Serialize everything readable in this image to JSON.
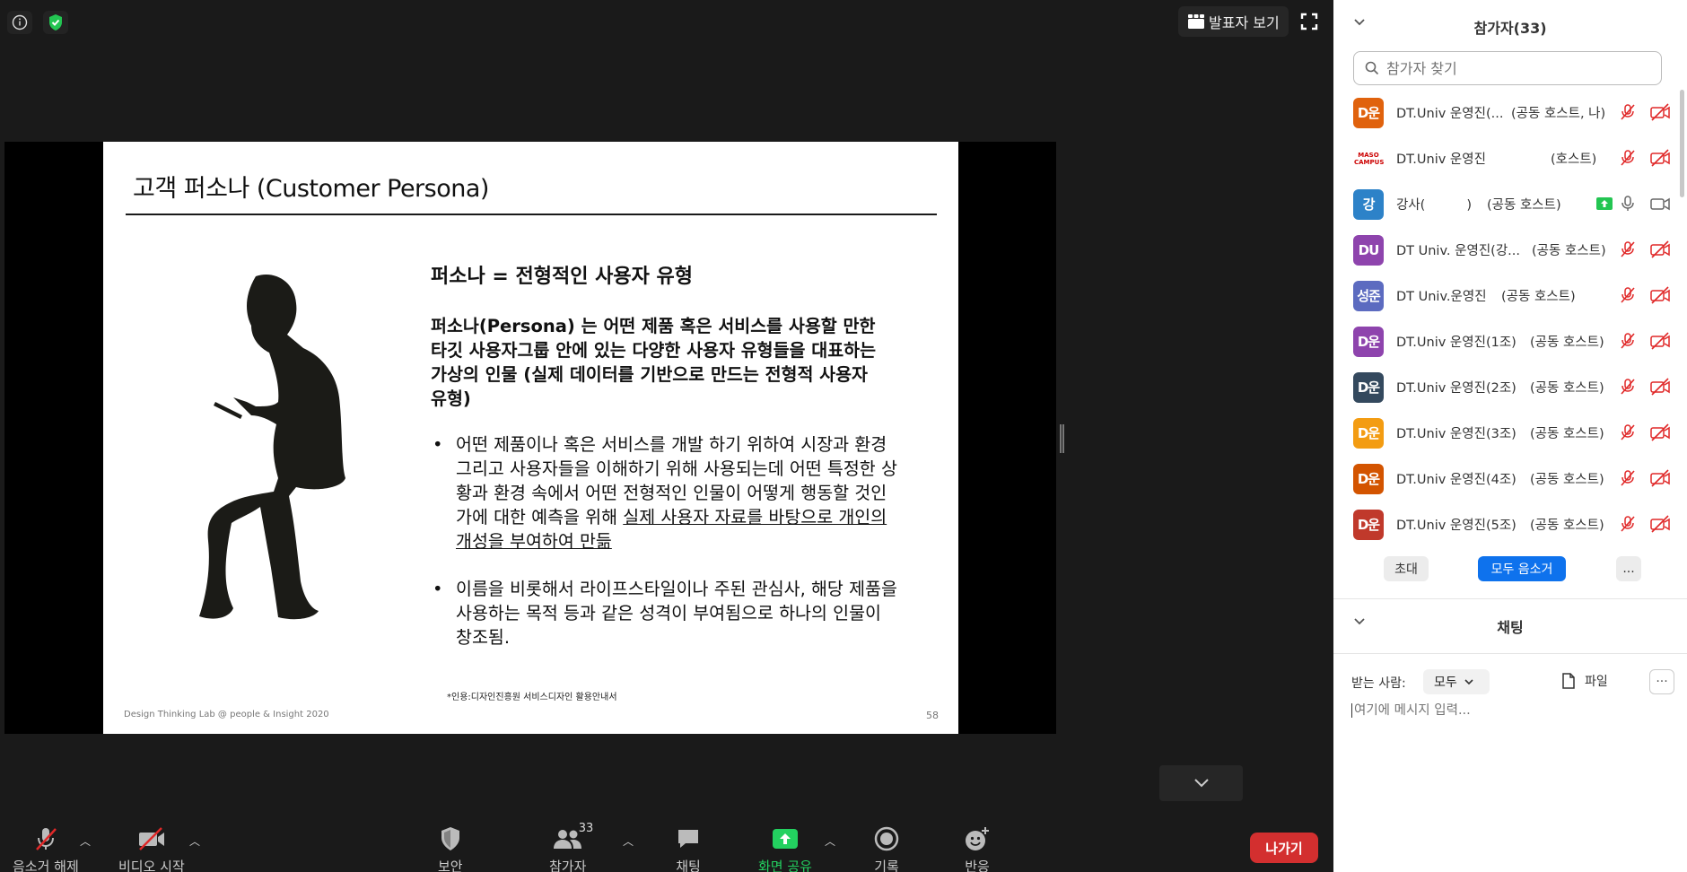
{
  "top_bar": {
    "info_icon": "info-icon",
    "security_icon": "shield-check-icon",
    "speaker_view_label": "발표자 보기",
    "fullscreen_icon": "fullscreen-icon"
  },
  "slide": {
    "title": "고객 퍼소나 (Customer Persona)",
    "heading": "퍼소나 = 전형적인 사용자 유형",
    "paragraph": "퍼소나(Persona) 는 어떤 제품 혹은 서비스를 사용할 만한 타깃 사용자그룹 안에 있는 다양한 사용자 유형들을 대표하는 가상의 인물 (실제 데이터를 기반으로 만드는 전형적 사용자 유형)",
    "bullet1_plain": "어떤 제품이나 혹은 서비스를 개발 하기 위하여 시장과 환경 그리고 사용자들을 이해하기 위해 사용되는데 어떤 특정한 상황과 환경 속에서 어떤 전형적인 인물이 어떻게 행동할 것인가에 대한 예측을 위해 ",
    "bullet1_underlined": "실제 사용자 자료를 바탕으로 개인의 개성을 부여하여 만듦",
    "bullet2": "이름을 비롯해서 라이프스타일이나 주된 관심사, 해당 제품을 사용하는 목적 등과 같은 성격이 부여됨으로 하나의 인물이 창조됨.",
    "citation": "*인용:디자인진흥원 서비스디자인 활용안내서",
    "footer": "Design Thinking Lab @ people & Insight 2020",
    "page_number": "58"
  },
  "toolbar": {
    "unmute_label": "음소거 해제",
    "video_label": "비디오 시작",
    "security_label": "보안",
    "participants_label": "참가자",
    "participants_count": "33",
    "chat_label": "채팅",
    "share_label": "화면 공유",
    "record_label": "기록",
    "reactions_label": "반응",
    "leave_label": "나가기"
  },
  "participants_panel": {
    "title": "참가자(33)",
    "search_placeholder": "참가자 찾기",
    "participants": [
      {
        "avatar": "D운",
        "color": "#e0620d",
        "name": "DT.Univ 운영진(...",
        "role": "(공동 호스트, 나)",
        "mic": "muted",
        "cam": "off"
      },
      {
        "avatar": "MASO CAMPUS",
        "color": "#ffffff",
        "name": "DT.Univ 운영진",
        "role": "(호스트)",
        "mic": "muted",
        "cam": "off"
      },
      {
        "avatar": "강",
        "color": "#2d82c8",
        "name": "강사(          )",
        "role": "(공동 호스트)",
        "mic": "on",
        "cam": "on",
        "sharing": true
      },
      {
        "avatar": "DU",
        "color": "#8e44ad",
        "name": "DT Univ. 운영진(강...",
        "role": "(공동 호스트)",
        "mic": "muted",
        "cam": "off"
      },
      {
        "avatar": "성준",
        "color": "#5c6bc0",
        "name": "DT Univ.운영진",
        "role": "(공동 호스트)",
        "mic": "muted",
        "cam": "off"
      },
      {
        "avatar": "D운",
        "color": "#8e44ad",
        "name": "DT.Univ 운영진(1조)",
        "role": "(공동 호스트)",
        "mic": "muted",
        "cam": "off"
      },
      {
        "avatar": "D운",
        "color": "#34495e",
        "name": "DT.Univ 운영진(2조)",
        "role": "(공동 호스트)",
        "mic": "muted",
        "cam": "off"
      },
      {
        "avatar": "D운",
        "color": "#f39c12",
        "name": "DT.Univ 운영진(3조)",
        "role": "(공동 호스트)",
        "mic": "muted",
        "cam": "off"
      },
      {
        "avatar": "D운",
        "color": "#d35400",
        "name": "DT.Univ 운영진(4조)",
        "role": "(공동 호스트)",
        "mic": "muted",
        "cam": "off"
      },
      {
        "avatar": "D운",
        "color": "#c0392b",
        "name": "DT.Univ 운영진(5조)",
        "role": "(공동 호스트)",
        "mic": "muted",
        "cam": "off"
      }
    ],
    "invite_label": "초대",
    "mute_all_label": "모두 음소거",
    "more_label": "..."
  },
  "chat_panel": {
    "title": "채팅",
    "to_label": "받는 사람:",
    "to_value": "모두",
    "file_label": "파일",
    "more_label": "···",
    "input_placeholder": "여기에 메시지 입력..."
  },
  "colors": {
    "accent_blue": "#0e72ed",
    "share_green": "#23d160",
    "leave_red": "#d32f2f",
    "muted_red": "#e02828"
  }
}
